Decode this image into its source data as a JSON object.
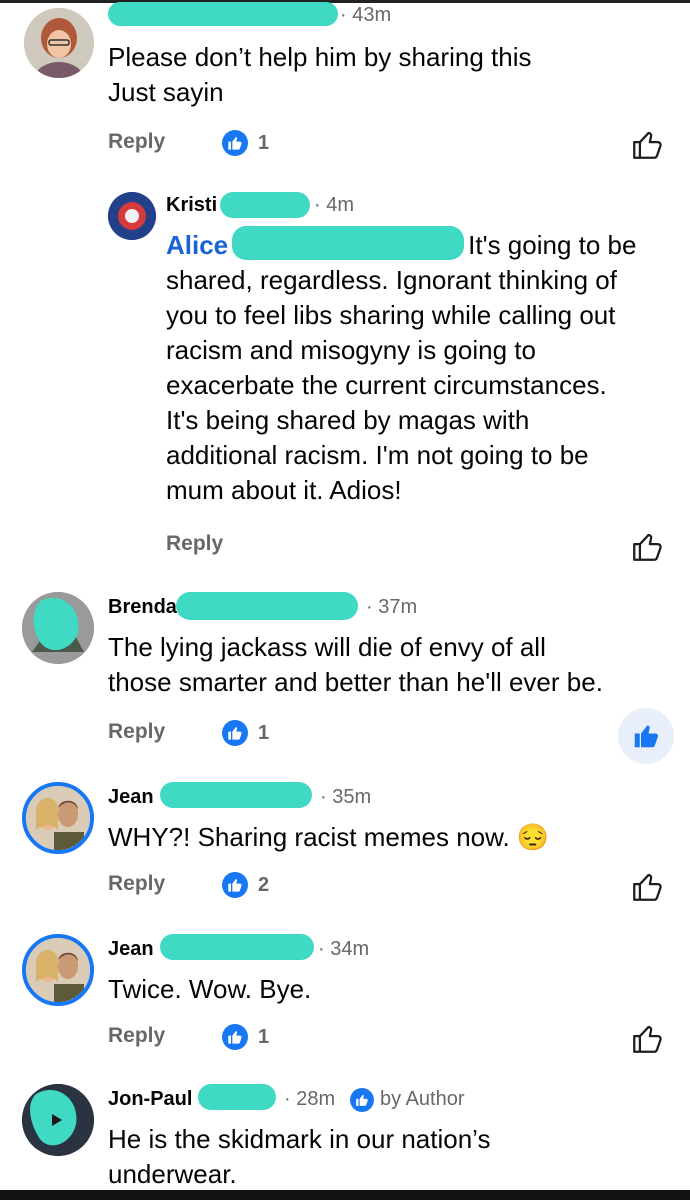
{
  "comments": [
    {
      "time": "· 43m",
      "text_line1": "Please don’t help him by sharing this",
      "text_line2": "Just sayin",
      "reply_label": "Reply",
      "like_count": "1"
    },
    {
      "name": "Kristi",
      "time": "· 4m",
      "mention": "Alice",
      "text_first": "It's going to be",
      "text_lines": [
        "shared, regardless. Ignorant thinking of",
        "you to feel libs sharing while calling out",
        "racism and misogyny is going to",
        "exacerbate the current circumstances.",
        "It's being shared by magas with",
        "additional racism. I'm not going to be",
        "mum about it. Adios!"
      ],
      "reply_label": "Reply"
    },
    {
      "name": "Brenda",
      "time": "· 37m",
      "text_line1": "The lying jackass will die of envy of all",
      "text_line2": "those smarter and better than he'll ever be.",
      "reply_label": "Reply",
      "like_count": "1"
    },
    {
      "name": "Jean",
      "time": "· 35m",
      "text_line1": "WHY?! Sharing racist memes now. 😔",
      "reply_label": "Reply",
      "like_count": "2"
    },
    {
      "name": "Jean",
      "time": "· 34m",
      "text_line1": "Twice. Wow. Bye.",
      "reply_label": "Reply",
      "like_count": "1"
    },
    {
      "name": "Jon-Paul",
      "time": "· 28m",
      "author_label": "by Author",
      "text_line1": "He is the skidmark in our nation’s",
      "text_line2": "underwear."
    }
  ],
  "colors": {
    "accent": "#1877f2",
    "redaction": "#3fd9c4",
    "meta_text": "#65676b",
    "mention": "#1a63d6"
  },
  "icons": {
    "like_badge": "thumbs-up-badge-icon",
    "like_button": "thumbs-up-outline-icon",
    "liked_button": "thumbs-up-filled-icon"
  }
}
